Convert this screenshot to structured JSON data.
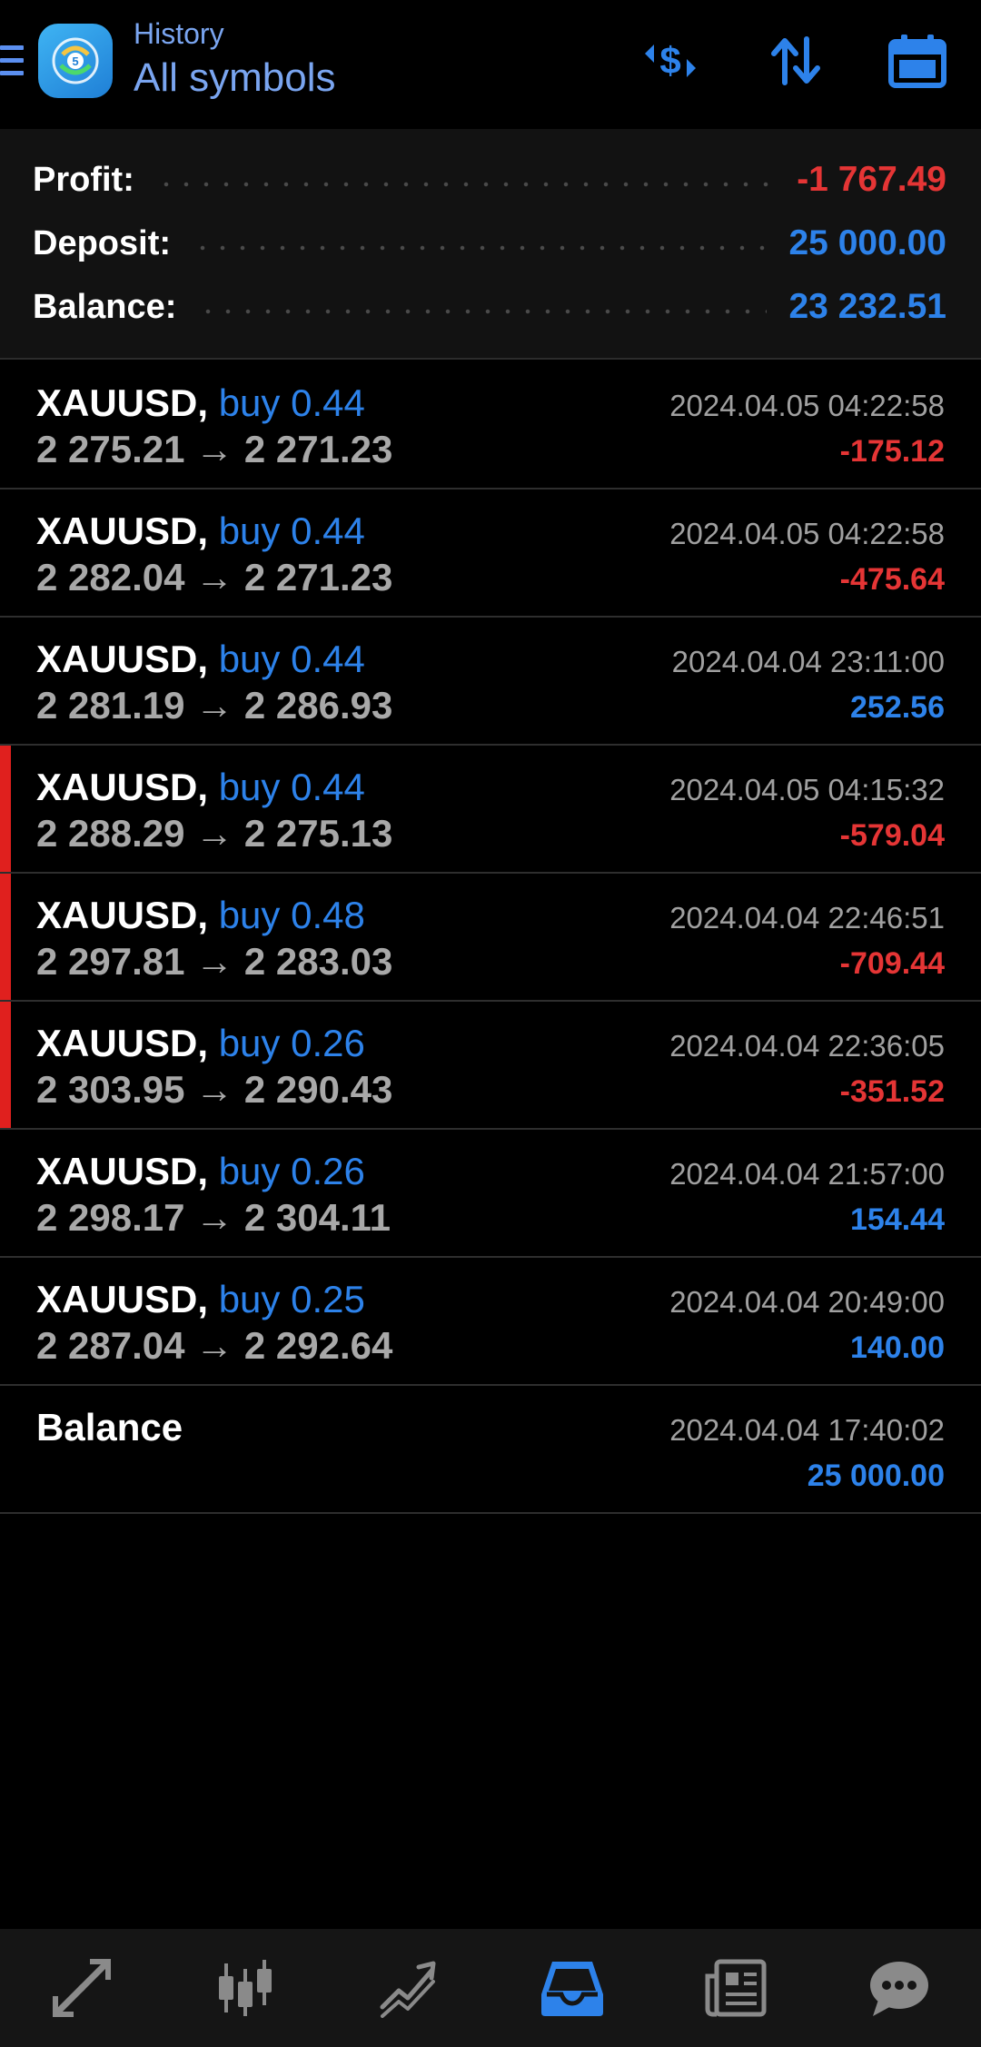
{
  "header": {
    "subtitle": "History",
    "title": "All symbols"
  },
  "summary": {
    "profit_label": "Profit:",
    "profit_value": "-1 767.49",
    "deposit_label": "Deposit:",
    "deposit_value": "25 000.00",
    "balance_label": "Balance:",
    "balance_value": "23 232.51"
  },
  "deals": [
    {
      "symbol": "XAUUSD,",
      "direction": "buy 0.44",
      "open": "2 275.21",
      "arrow": "→",
      "close": "2 271.23",
      "time": "2024.04.05 04:22:58",
      "profit": "-175.12"
    },
    {
      "symbol": "XAUUSD,",
      "direction": "buy 0.44",
      "open": "2 282.04",
      "arrow": "→",
      "close": "2 271.23",
      "time": "2024.04.05 04:22:58",
      "profit": "-475.64"
    },
    {
      "symbol": "XAUUSD,",
      "direction": "buy 0.44",
      "open": "2 281.19",
      "arrow": "→",
      "close": "2 286.93",
      "time": "2024.04.04 23:11:00",
      "profit": "252.56"
    },
    {
      "symbol": "XAUUSD,",
      "direction": "buy 0.44",
      "open": "2 288.29",
      "arrow": "→",
      "close": "2 275.13",
      "time": "2024.04.05 04:15:32",
      "profit": "-579.04"
    },
    {
      "symbol": "XAUUSD,",
      "direction": "buy 0.48",
      "open": "2 297.81",
      "arrow": "→",
      "close": "2 283.03",
      "time": "2024.04.04 22:46:51",
      "profit": "-709.44"
    },
    {
      "symbol": "XAUUSD,",
      "direction": "buy 0.26",
      "open": "2 303.95",
      "arrow": "→",
      "close": "2 290.43",
      "time": "2024.04.04 22:36:05",
      "profit": "-351.52"
    },
    {
      "symbol": "XAUUSD,",
      "direction": "buy 0.26",
      "open": "2 298.17",
      "arrow": "→",
      "close": "2 304.11",
      "time": "2024.04.04 21:57:00",
      "profit": "154.44"
    },
    {
      "symbol": "XAUUSD,",
      "direction": "buy 0.25",
      "open": "2 287.04",
      "arrow": "→",
      "close": "2 292.64",
      "time": "2024.04.04 20:49:00",
      "profit": "140.00"
    }
  ],
  "balance_entry": {
    "label": "Balance",
    "time": "2024.04.04 17:40:02",
    "amount": "25 000.00"
  },
  "icons": {
    "menu": "hamburger-icon",
    "logo": "metatrader-logo",
    "deposit_op": "dollar-swap-icon",
    "sort": "sort-arrows-icon",
    "calendar": "calendar-icon",
    "nav": [
      "quotes-icon",
      "chart-icon",
      "trade-icon",
      "history-icon",
      "news-icon",
      "messages-icon"
    ]
  },
  "colors": {
    "accent_blue": "#2d82ea",
    "loss_red": "#e53535",
    "marker_red": "#e0201e",
    "header_text": "#7aa5f0",
    "nav_active": "#2d82ea",
    "nav_inactive": "#8a8a8a"
  }
}
